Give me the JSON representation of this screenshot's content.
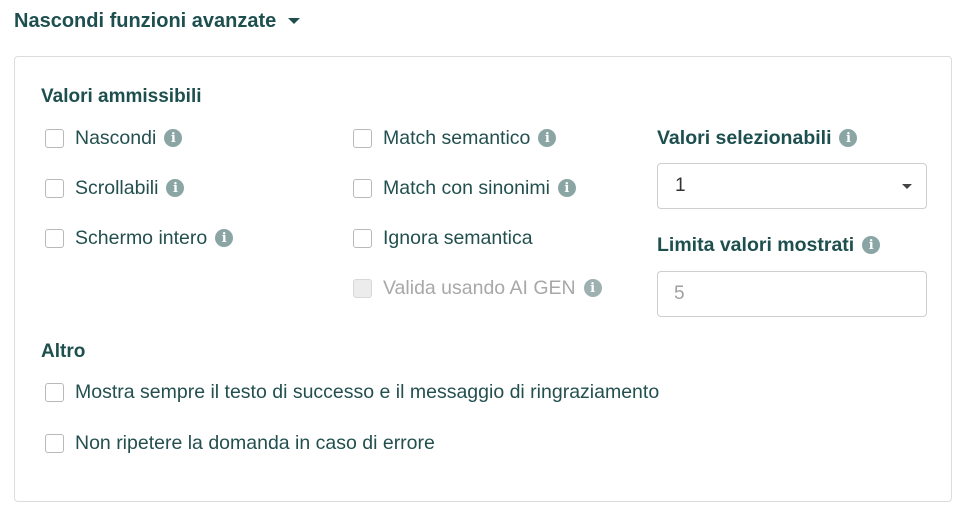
{
  "header": {
    "toggle_label": "Nascondi funzioni avanzate"
  },
  "valori": {
    "title": "Valori ammissibili",
    "col1": [
      {
        "label": "Nascondi"
      },
      {
        "label": "Scrollabili"
      },
      {
        "label": "Schermo intero"
      }
    ],
    "col2": [
      {
        "label": "Match semantico"
      },
      {
        "label": "Match con sinonimi"
      },
      {
        "label": "Ignora semantica"
      },
      {
        "label": "Valida usando AI GEN"
      }
    ],
    "selezionabili": {
      "label": "Valori selezionabili",
      "value": "1"
    },
    "limita": {
      "label": "Limita valori mostrati",
      "placeholder": "5"
    }
  },
  "altro": {
    "title": "Altro",
    "items": [
      {
        "label": "Mostra sempre il testo di successo e il messaggio di ringraziamento"
      },
      {
        "label": "Non ripetere la domanda in caso di errore"
      }
    ]
  },
  "icons": {
    "info": "info-icon",
    "caret": "caret-down-icon",
    "dropdown": "dropdown-arrow-icon"
  },
  "colors": {
    "text": "#1e4f4f",
    "info_icon": "#8ba5a5",
    "border": "#dcdcdc"
  }
}
